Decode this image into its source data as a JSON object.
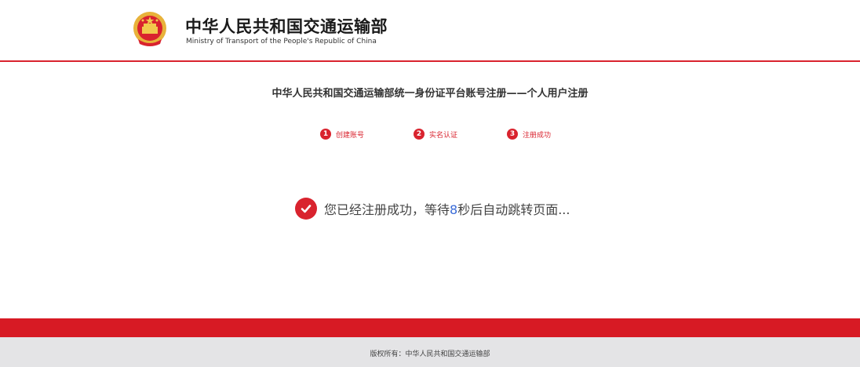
{
  "header": {
    "title_cn": "中华人民共和国交通运输部",
    "title_en": "Ministry of Transport of the People's Republic of China",
    "emblem_icon": "national-emblem-icon"
  },
  "main": {
    "heading": "中华人民共和国交通运输部统一身份证平台账号注册——个人用户注册",
    "steps": [
      {
        "num": "1",
        "label": "创建账号"
      },
      {
        "num": "2",
        "label": "实名认证"
      },
      {
        "num": "3",
        "label": "注册成功"
      }
    ],
    "success": {
      "icon": "check-circle-icon",
      "prefix": "您已经注册成功，等待",
      "countdown": "8",
      "suffix": "秒后自动跳转页面..."
    }
  },
  "footer": {
    "text": "版权所有：中华人民共和国交通运输部"
  },
  "colors": {
    "brand_red": "#d9232e",
    "footer_gray": "#e4e4e6",
    "countdown_blue": "#3a6bd8"
  }
}
